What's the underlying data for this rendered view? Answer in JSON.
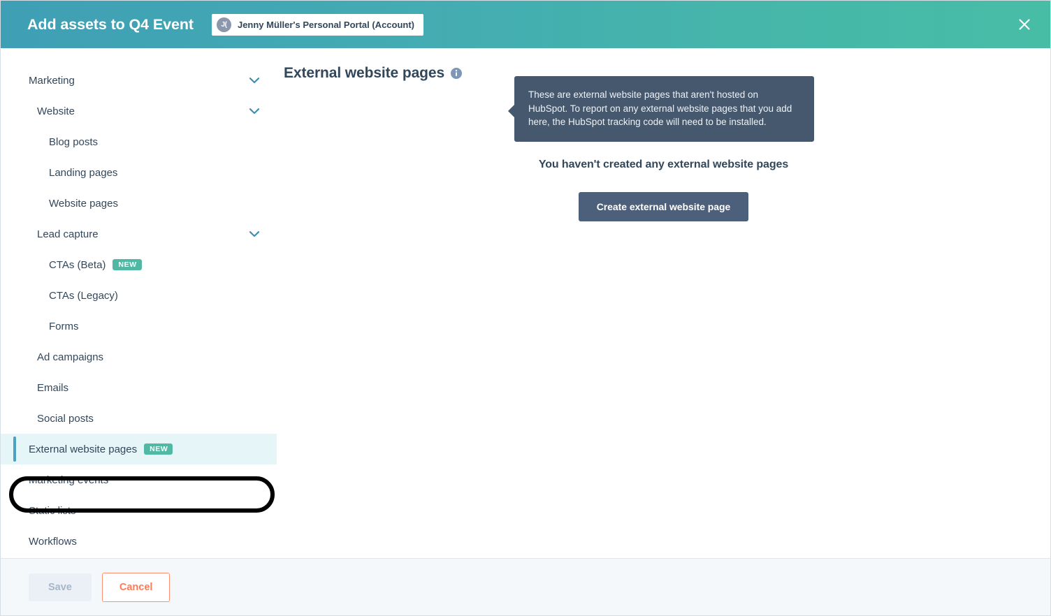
{
  "header": {
    "title": "Add assets to Q4 Event",
    "account": {
      "avatar_initials": "J(",
      "name": "Jenny Müller's Personal Portal (Account)"
    },
    "close_label": "Close",
    "gradient_start": "#3f9fb5",
    "gradient_end": "#48bda6"
  },
  "sidebar": {
    "items": [
      {
        "label": "Marketing",
        "level": 0,
        "chevron": true,
        "badge": null,
        "selected": false
      },
      {
        "label": "Website",
        "level": 1,
        "chevron": true,
        "badge": null,
        "selected": false
      },
      {
        "label": "Blog posts",
        "level": 2,
        "chevron": false,
        "badge": null,
        "selected": false
      },
      {
        "label": "Landing pages",
        "level": 2,
        "chevron": false,
        "badge": null,
        "selected": false
      },
      {
        "label": "Website pages",
        "level": 2,
        "chevron": false,
        "badge": null,
        "selected": false
      },
      {
        "label": "Lead capture",
        "level": 1,
        "chevron": true,
        "badge": null,
        "selected": false
      },
      {
        "label": "CTAs (Beta)",
        "level": 2,
        "chevron": false,
        "badge": "NEW",
        "selected": false
      },
      {
        "label": "CTAs (Legacy)",
        "level": 2,
        "chevron": false,
        "badge": null,
        "selected": false
      },
      {
        "label": "Forms",
        "level": 2,
        "chevron": false,
        "badge": null,
        "selected": false
      },
      {
        "label": "Ad campaigns",
        "level": 1,
        "chevron": false,
        "badge": null,
        "selected": false
      },
      {
        "label": "Emails",
        "level": 1,
        "chevron": false,
        "badge": null,
        "selected": false
      },
      {
        "label": "Social posts",
        "level": 1,
        "chevron": false,
        "badge": null,
        "selected": false
      },
      {
        "label": "External website pages",
        "level": 0,
        "chevron": false,
        "badge": "NEW",
        "selected": true
      },
      {
        "label": "Marketing events",
        "level": 0,
        "chevron": false,
        "badge": null,
        "selected": false
      },
      {
        "label": "Static lists",
        "level": 0,
        "chevron": false,
        "badge": null,
        "selected": false
      },
      {
        "label": "Workflows",
        "level": 0,
        "chevron": false,
        "badge": null,
        "selected": false
      }
    ],
    "badge_color": "#51b9a3",
    "selected_bg": "#e5f5f8",
    "selected_accent": "#4ba3c3"
  },
  "main": {
    "heading": "External website pages",
    "info_icon_name": "info-icon",
    "tooltip": "These are external website pages that aren't hosted on HubSpot. To report on any external website pages that you add here, the HubSpot tracking code will need to be installed.",
    "empty_title": "You haven't created any external website pages",
    "create_button": "Create external website page",
    "create_button_color": "#4c5f7b"
  },
  "footer": {
    "save_label": "Save",
    "cancel_label": "Cancel",
    "save_disabled": true,
    "cancel_color": "#ff7a59"
  }
}
